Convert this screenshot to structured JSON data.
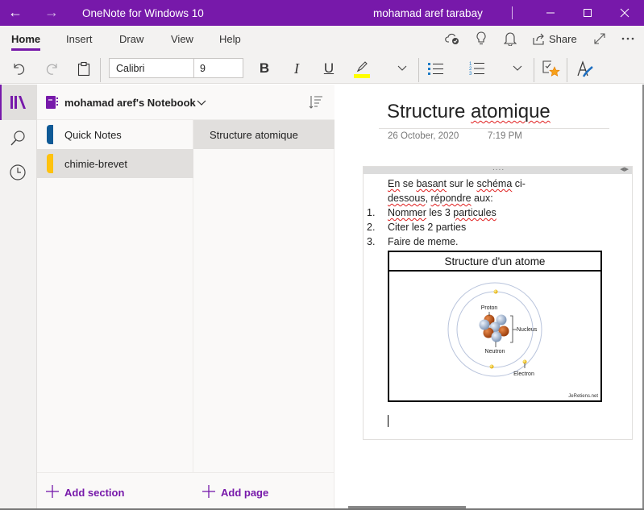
{
  "titlebar": {
    "app_title": "OneNote for Windows 10",
    "user_name": "mohamad aref tarabay",
    "back_icon": "back-arrow-icon",
    "forward_icon": "forward-arrow-icon",
    "minimize_icon": "minimize-icon",
    "maximize_icon": "maximize-icon",
    "close_icon": "close-icon",
    "color": "#7719aa"
  },
  "ribbon": {
    "tabs": [
      {
        "label": "Home",
        "active": true
      },
      {
        "label": "Insert",
        "active": false
      },
      {
        "label": "Draw",
        "active": false
      },
      {
        "label": "View",
        "active": false
      },
      {
        "label": "Help",
        "active": false
      }
    ],
    "share_label": "Share",
    "font_name": "Calibri",
    "font_size": "9",
    "bold_label": "B",
    "italic_label": "I",
    "underline_label": "U",
    "highlight_color": "#ffff00"
  },
  "notebook": {
    "title": "mohamad aref's Notebook",
    "sections": [
      {
        "label": "Quick Notes",
        "color": "#0f5a96",
        "selected": false
      },
      {
        "label": "chimie-brevet",
        "color": "#ffc20e",
        "selected": true
      }
    ],
    "pages": [
      {
        "label": "Structure atomique",
        "selected": true
      }
    ],
    "add_section_label": "Add section",
    "add_page_label": "Add page"
  },
  "page": {
    "title_plain": "Structure ",
    "title_spell": "atomique",
    "date": "26 October, 2020",
    "time": "7:19 PM",
    "note": {
      "intro_line1_a": "En",
      "intro_line1_b": " se ",
      "intro_line1_c": "basant",
      "intro_line1_d": " sur le ",
      "intro_line1_e": "schéma",
      "intro_line1_f": " ci-",
      "intro_line2_a": "dessous",
      "intro_line2_b": ", ",
      "intro_line2_c": "répondre",
      "intro_line2_d": " aux:",
      "list": [
        {
          "num": "1.",
          "spell": "Nommer",
          "mid": " les 3 ",
          "spell2": "particules"
        },
        {
          "num": "2.",
          "text": "Citer les 2 parties"
        },
        {
          "num": "3.",
          "text": "Faire de meme."
        }
      ],
      "table_header": "Structure d'un atome",
      "diagram_labels": {
        "proton": "Proton",
        "nucleus": "Nucleus",
        "neutron": "Neutron",
        "electron": "Electron"
      },
      "credit": "JeRetiens.net"
    }
  }
}
